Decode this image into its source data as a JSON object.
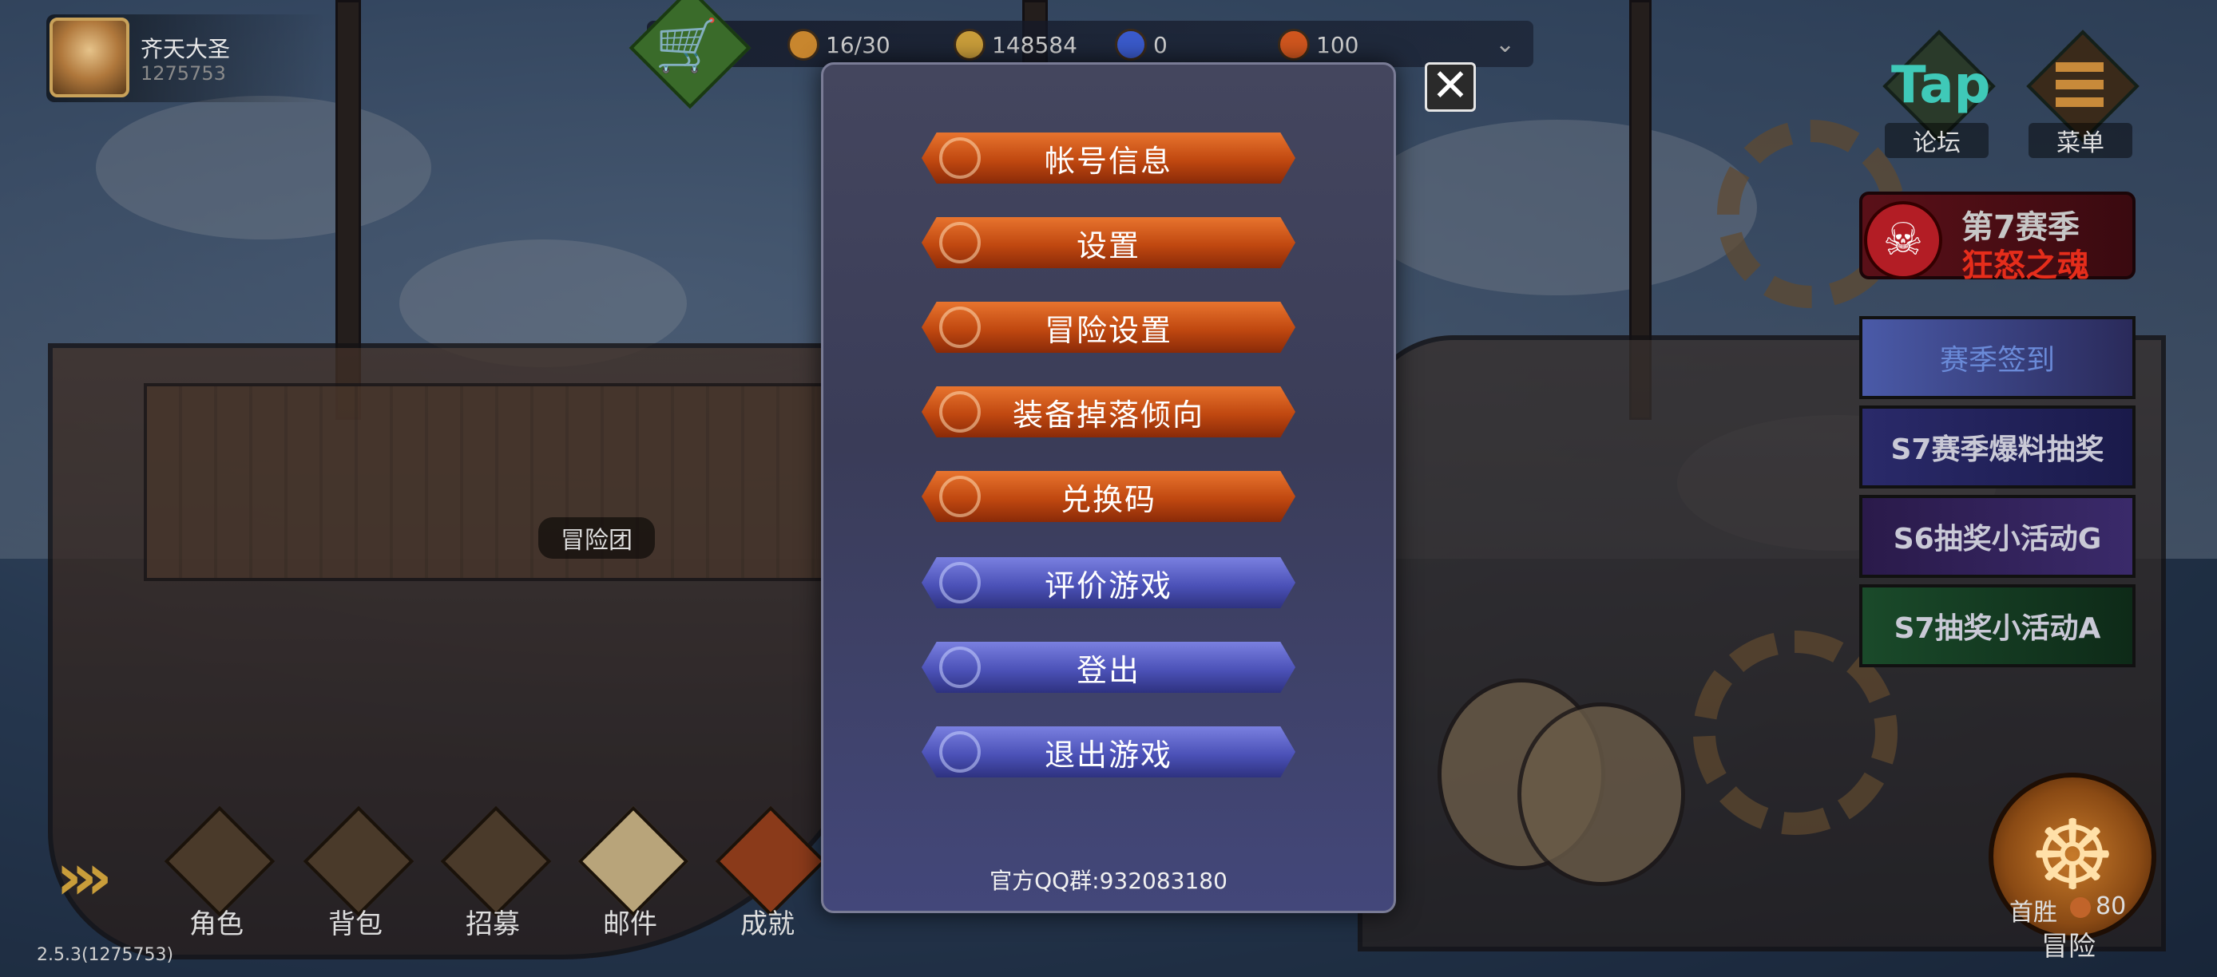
{
  "player": {
    "name": "齐天大圣",
    "id": "1275753"
  },
  "resources": [
    {
      "icon": "bread-icon",
      "value": "16/30",
      "color": "#c8862e"
    },
    {
      "icon": "gold-coin-icon",
      "value": "148584",
      "color": "#c99d3a"
    },
    {
      "icon": "blue-gem-icon",
      "value": "0",
      "color": "#3a5acb"
    },
    {
      "icon": "orange-gem-icon",
      "value": "100",
      "color": "#d0561e"
    }
  ],
  "side": {
    "tap_logo": "Tap",
    "forum_label": "论坛",
    "menu_label": "菜单",
    "season_line1": "第7赛季",
    "season_line2": "狂怒之魂",
    "banners": [
      "赛季签到",
      "S7赛季爆料抽奖",
      "S6抽奖小活动G",
      "S7抽奖小活动A"
    ]
  },
  "deck_labels": [
    "冒险团"
  ],
  "bottom_nav": [
    "角色",
    "背包",
    "招募",
    "邮件",
    "成就"
  ],
  "adventure": {
    "first_win_label": "首胜",
    "first_win_value": "80",
    "label": "冒险"
  },
  "version": "2.5.3(1275753)",
  "modal": {
    "buttons": [
      {
        "label": "帐号信息",
        "style": "orange"
      },
      {
        "label": "设置",
        "style": "orange"
      },
      {
        "label": "冒险设置",
        "style": "orange"
      },
      {
        "label": "装备掉落倾向",
        "style": "orange"
      },
      {
        "label": "兑换码",
        "style": "orange"
      },
      {
        "label": "评价游戏",
        "style": "purple"
      },
      {
        "label": "登出",
        "style": "purple"
      },
      {
        "label": "退出游戏",
        "style": "purple"
      }
    ],
    "qq_group": "官方QQ群:932083180",
    "close_glyph": "✕"
  }
}
